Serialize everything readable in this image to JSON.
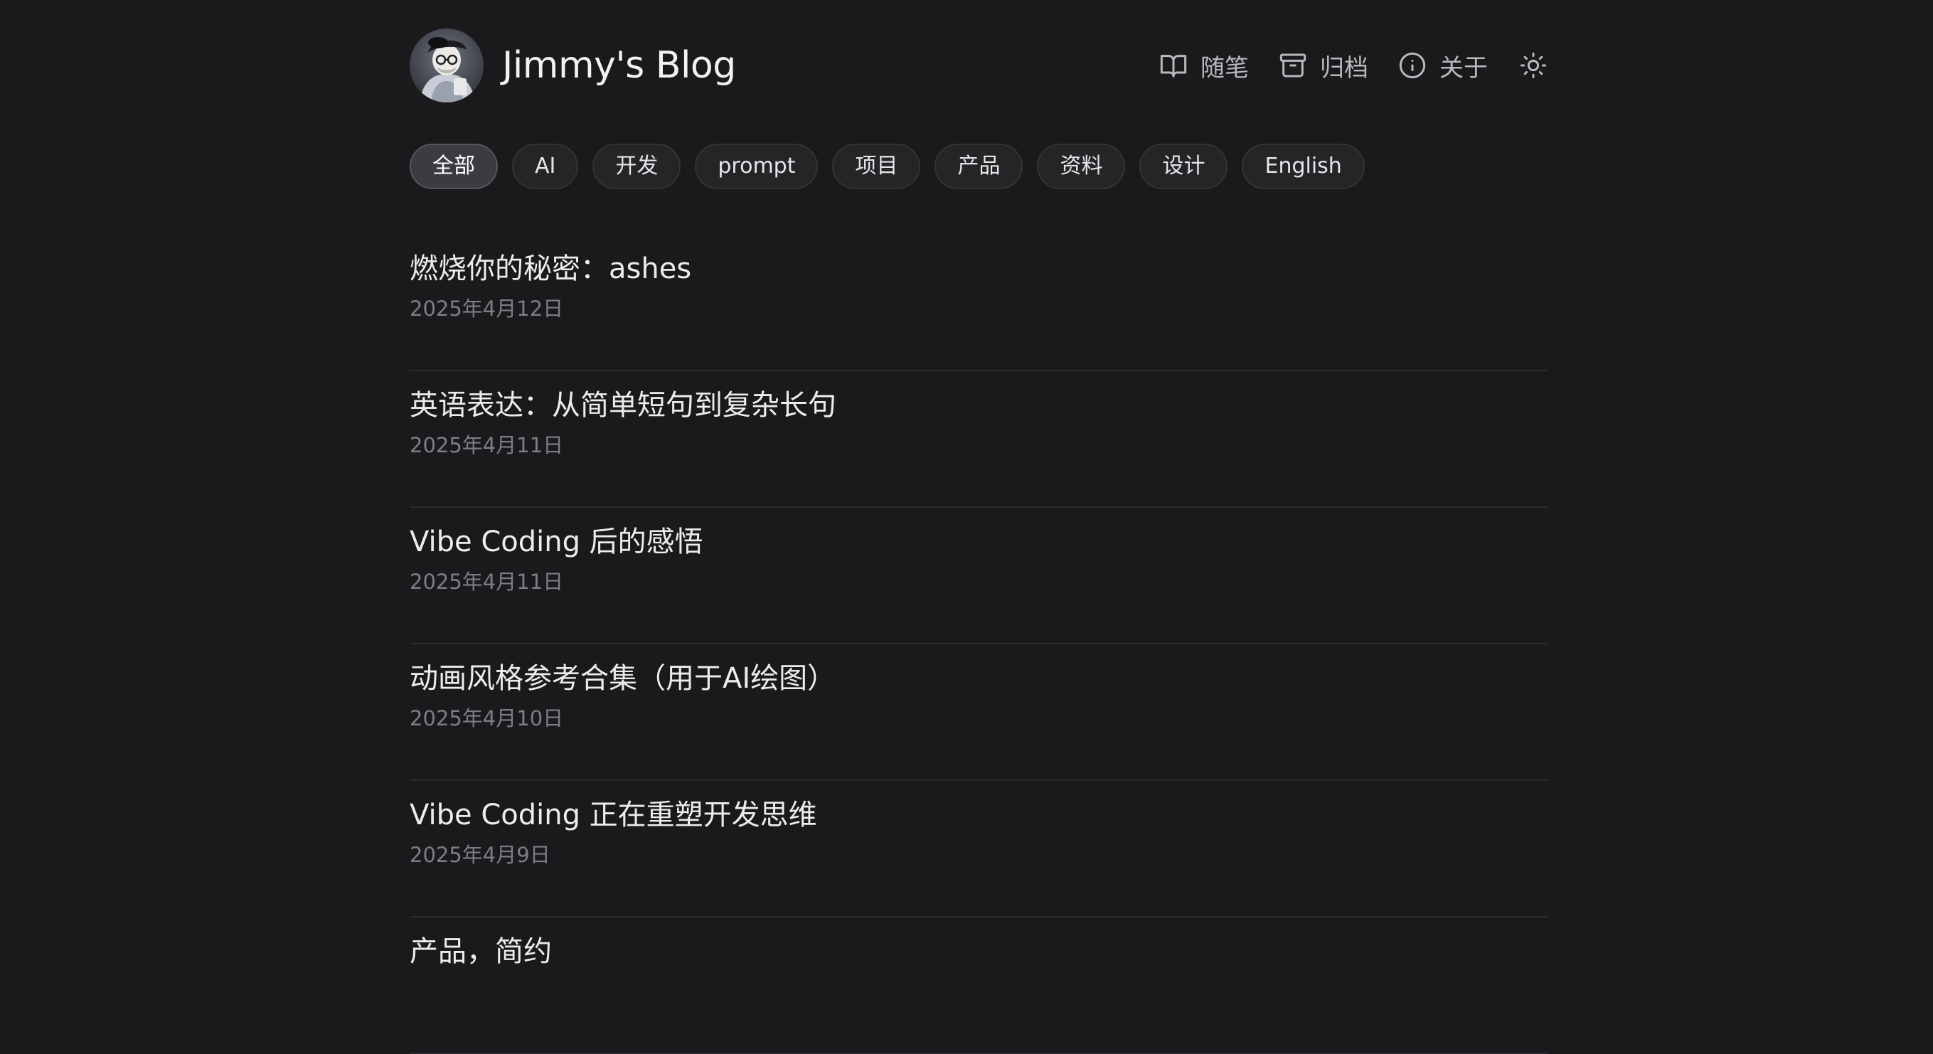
{
  "header": {
    "site_title": "Jimmy's Blog",
    "avatar_icon": "avatar-cartoon-portrait"
  },
  "nav": {
    "items": [
      {
        "label": "随笔",
        "icon": "book-open-icon"
      },
      {
        "label": "归档",
        "icon": "archive-icon"
      },
      {
        "label": "关于",
        "icon": "info-icon"
      }
    ],
    "theme_toggle_icon": "sun-icon"
  },
  "tags": {
    "active": "全部",
    "items": [
      "全部",
      "AI",
      "开发",
      "prompt",
      "项目",
      "产品",
      "资料",
      "设计",
      "English"
    ]
  },
  "posts": [
    {
      "title": "燃烧你的秘密：ashes",
      "date": "2025年4月12日"
    },
    {
      "title": "英语表达：从简单短句到复杂长句",
      "date": "2025年4月11日"
    },
    {
      "title": "Vibe Coding 后的感悟",
      "date": "2025年4月11日"
    },
    {
      "title": "动画风格参考合集（用于AI绘图）",
      "date": "2025年4月10日"
    },
    {
      "title": "Vibe Coding 正在重塑开发思维",
      "date": "2025年4月9日"
    },
    {
      "title": "产品，简约",
      "date": ""
    }
  ],
  "colors": {
    "background": "#1a1a1c",
    "text_primary": "#ececef",
    "text_muted": "#7d7d84",
    "tag_bg": "#252528",
    "tag_active_bg": "#3b3b40",
    "divider": "#2c2c30"
  }
}
